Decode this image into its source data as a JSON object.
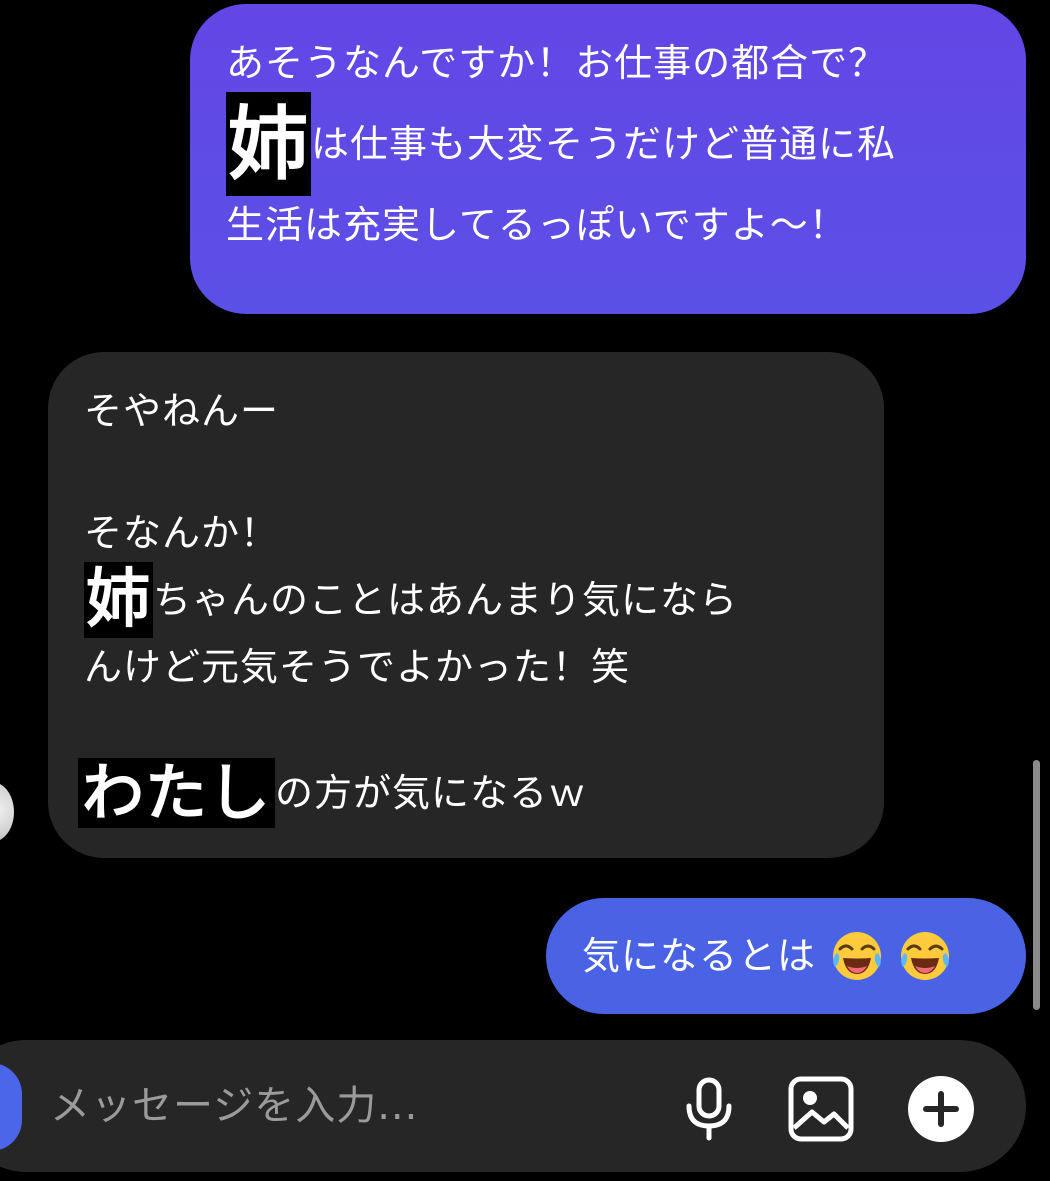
{
  "messages": {
    "outgoing_1": {
      "line_1": "あそうなんですか！お仕事の都合で？",
      "line_2_highlight": "姉",
      "line_2_rest": "は仕事も大変そうだけど普通に私",
      "line_3": "生活は充実してるっぽいですよ〜！"
    },
    "incoming": {
      "line_1": "そやねんー",
      "line_2": "そなんか！",
      "line_3_highlight": "姉",
      "line_3_rest": "ちゃんのことはあんまり気になら",
      "line_4": "んけど元気そうでよかった！笑",
      "line_5_highlight": "わたし",
      "line_5_rest": "の方が気になるｗ"
    },
    "outgoing_2": {
      "text": "気になるとは",
      "emoji_name": "face-with-tears-of-joy-icon"
    }
  },
  "composer": {
    "placeholder": "メッセージを入力..."
  },
  "colors": {
    "background": "#000000",
    "outgoing_bubble_top": "#6446e6",
    "outgoing_bubble_bottom": "#5a50e6",
    "outgoing_bubble_2": "#4a63e4",
    "incoming_bubble": "#262626",
    "composer": "#262626",
    "accent": "#4b66e8"
  },
  "icons": {
    "mic": "microphone-icon",
    "image": "image-icon",
    "plus": "plus-circle-icon"
  }
}
